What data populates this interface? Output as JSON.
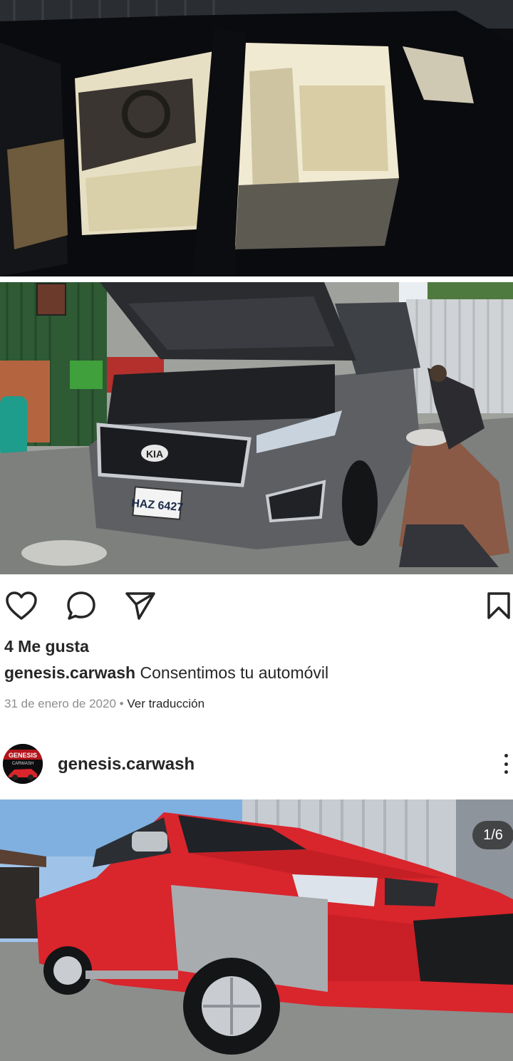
{
  "post1": {
    "likes_text": "4 Me gusta",
    "caption_user": "genesis.carwash",
    "caption_text": "Consentimos tu automóvil",
    "date": "31 de enero de 2020",
    "separator": "•",
    "translate_label": "Ver traducción",
    "plate_text": "HAZ 6427",
    "badge_text": "KIA"
  },
  "post2": {
    "username": "genesis.carwash",
    "avatar_text": "GENESIS",
    "avatar_subtext": "CARWASH",
    "carousel_counter": "1/6"
  },
  "icons": {
    "like": "heart-icon",
    "comment": "comment-icon",
    "share": "paper-plane-icon",
    "save": "bookmark-icon",
    "more": "more-vertical-icon"
  },
  "colors": {
    "text": "#262626",
    "meta": "#8e8e8e",
    "pickup_red": "#d9252c"
  }
}
